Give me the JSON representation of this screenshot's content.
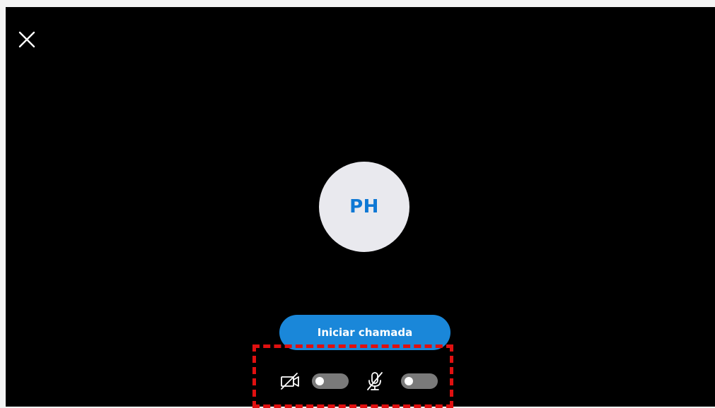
{
  "window": {
    "background": "#000000",
    "close_icon": "close-icon"
  },
  "avatar": {
    "initials": "PH",
    "text_color": "#0f78d4",
    "background": "#e9e9ee"
  },
  "call": {
    "start_label": "Iniciar chamada",
    "button_color": "#1a87d9"
  },
  "media_controls": {
    "video": {
      "icon": "video-off-icon",
      "enabled": false
    },
    "microphone": {
      "icon": "microphone-off-icon",
      "enabled": false
    },
    "toggle_off_color": "#7a7a7a"
  },
  "annotation": {
    "highlight_color": "#e01010",
    "style": "dashed"
  }
}
